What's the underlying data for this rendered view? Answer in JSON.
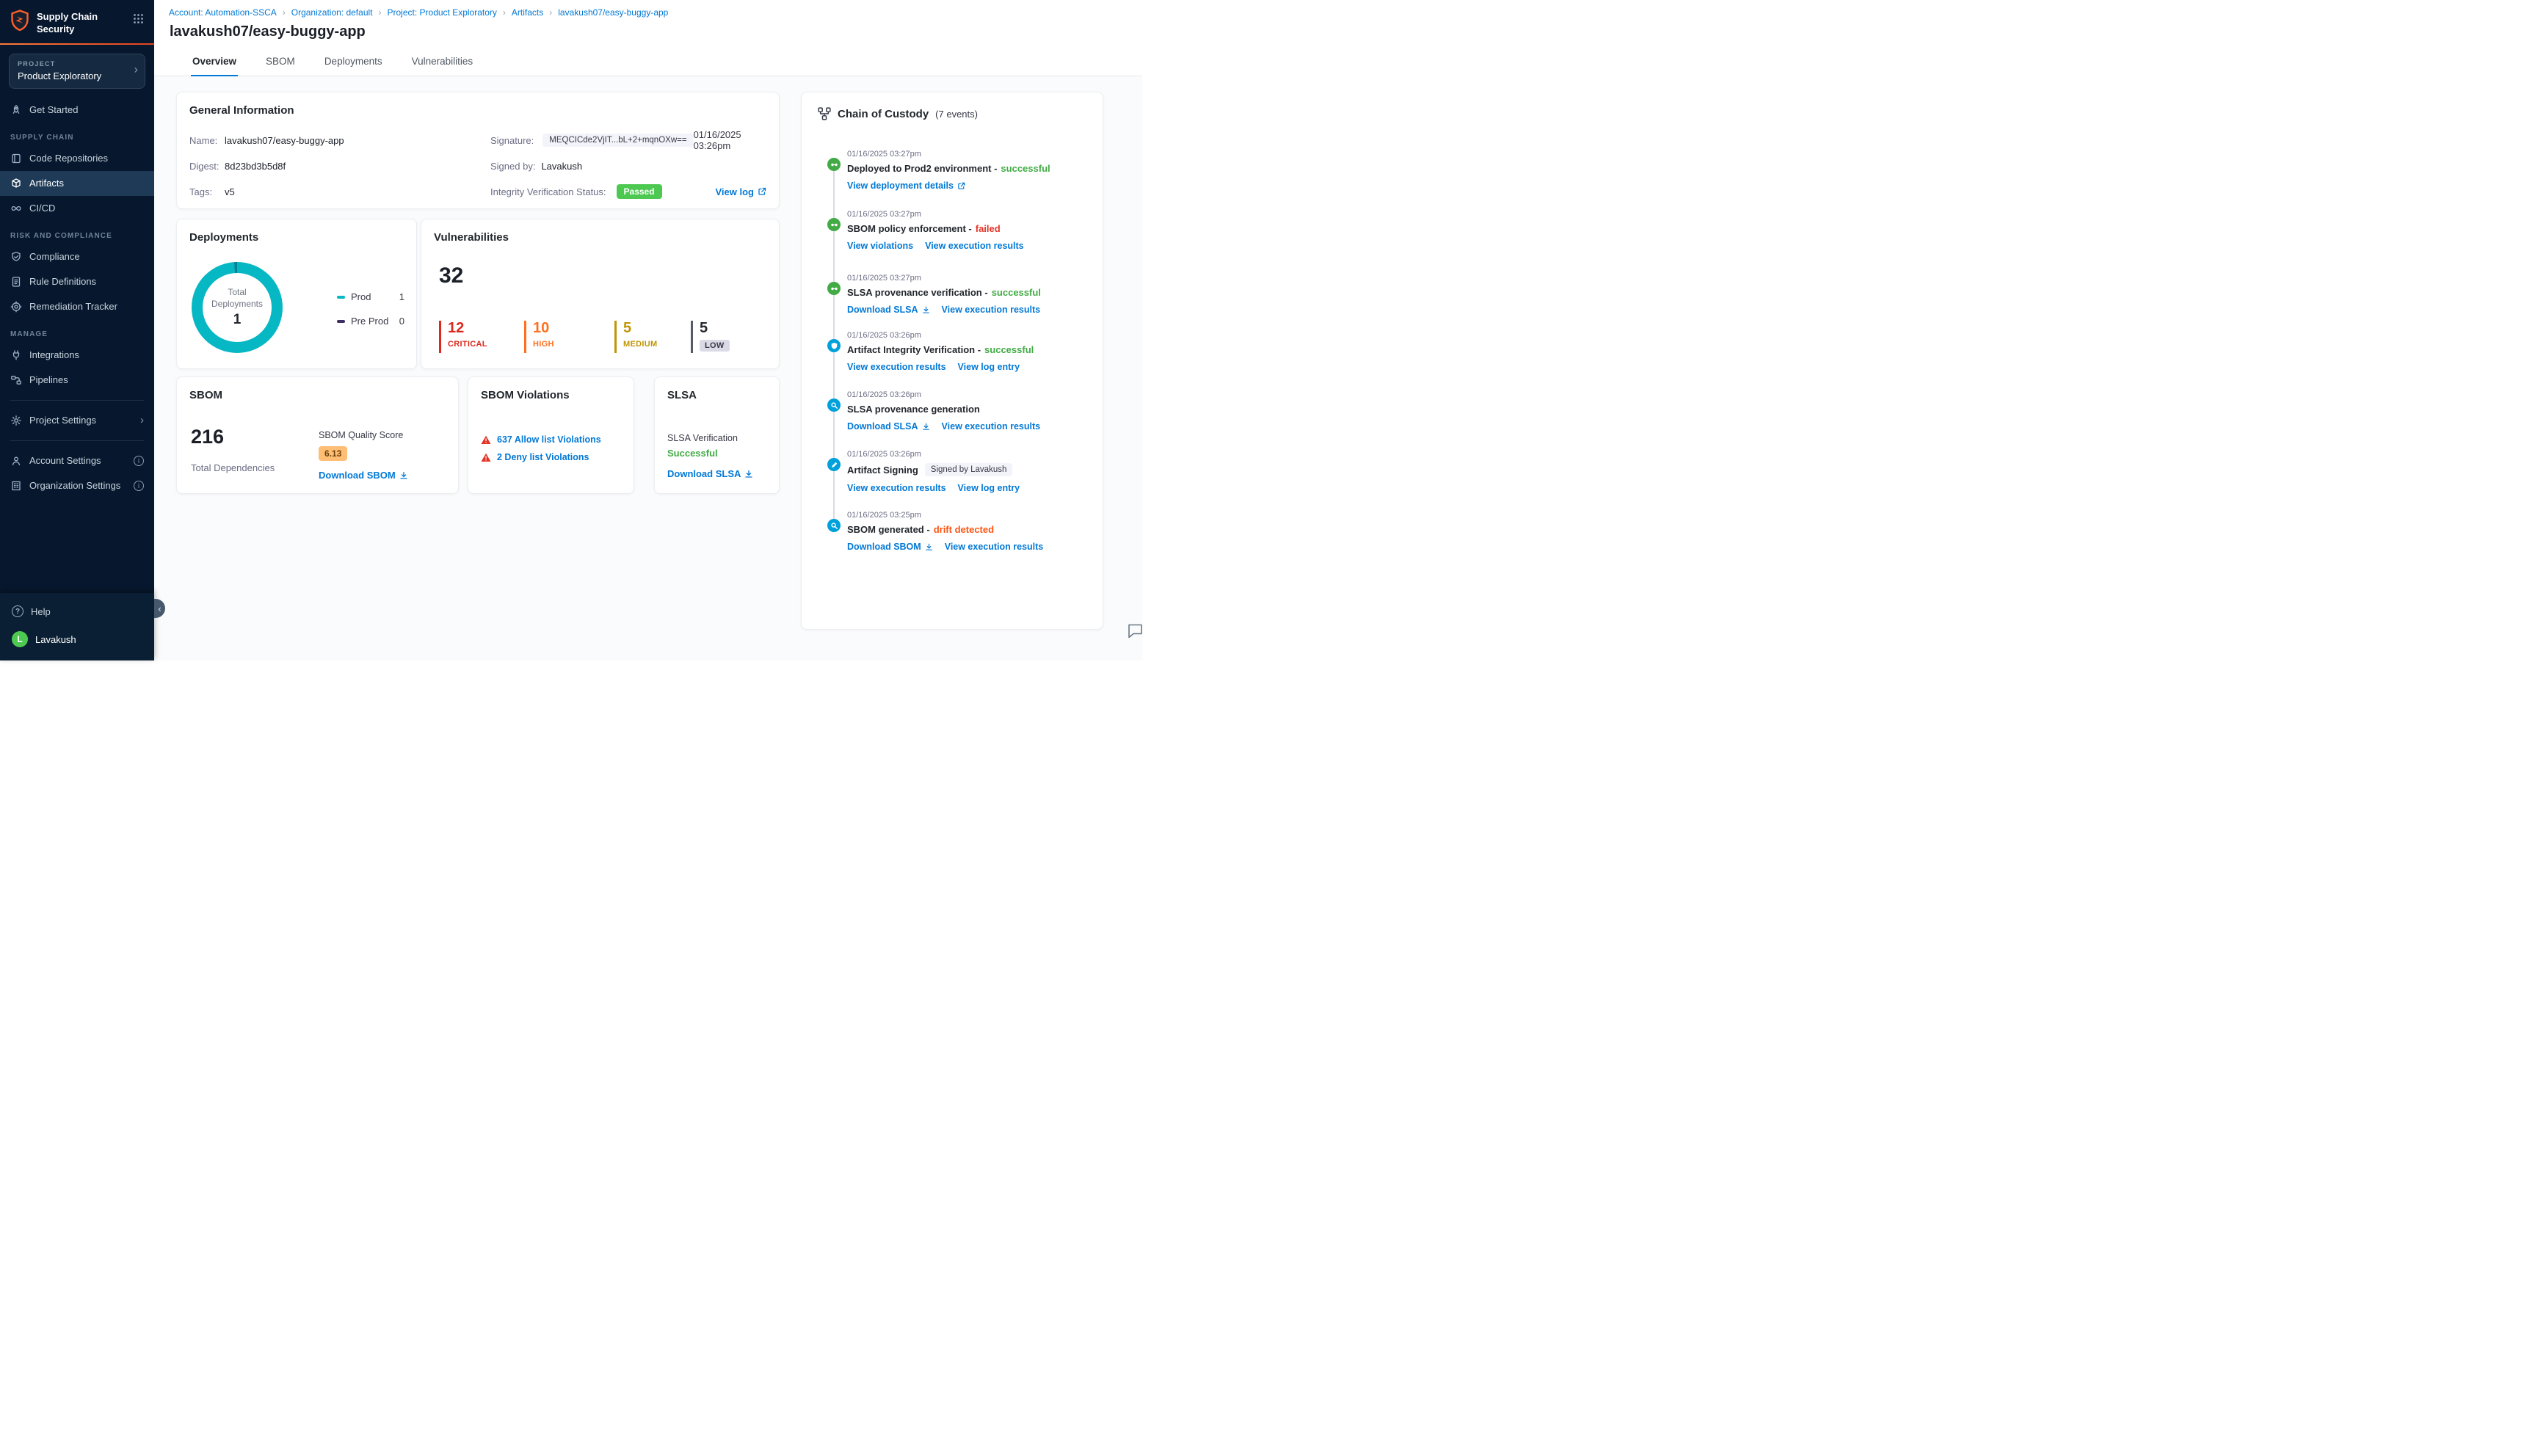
{
  "colors": {
    "primary_blue": "#0278d5",
    "success_green": "#42ab45",
    "failed_red": "#e43326",
    "drift_orange": "#ff5310",
    "passed_badge_green": "#4dc952",
    "sidebar_bg": "#07182e",
    "donut_teal": "#06b7c4",
    "preprod_purple": "#3f2e63"
  },
  "sidebar": {
    "brand_line1": "Supply Chain",
    "brand_line2": "Security",
    "project_label": "PROJECT",
    "project_name": "Product Exploratory",
    "get_started": "Get Started",
    "supply_chain_header": "SUPPLY CHAIN",
    "code_repositories": "Code Repositories",
    "artifacts": "Artifacts",
    "cicd": "CI/CD",
    "risk_header": "RISK AND COMPLIANCE",
    "compliance": "Compliance",
    "rule_definitions": "Rule Definitions",
    "remediation_tracker": "Remediation Tracker",
    "manage_header": "MANAGE",
    "integrations": "Integrations",
    "pipelines": "Pipelines",
    "project_settings": "Project Settings",
    "account_settings": "Account Settings",
    "organization_settings": "Organization Settings",
    "help": "Help",
    "user_initial": "L",
    "user_name": "Lavakush"
  },
  "breadcrumb": {
    "items": [
      "Account: Automation-SSCA",
      "Organization: default",
      "Project: Product Exploratory",
      "Artifacts",
      "lavakush07/easy-buggy-app"
    ]
  },
  "page": {
    "title": "lavakush07/easy-buggy-app",
    "tabs": [
      "Overview",
      "SBOM",
      "Deployments",
      "Vulnerabilities"
    ]
  },
  "general": {
    "title": "General Information",
    "name_label": "Name:",
    "name_value": "lavakush07/easy-buggy-app",
    "digest_label": "Digest:",
    "digest_value": "8d23bd3b5d8f",
    "tags_label": "Tags:",
    "tags_value": "v5",
    "signature_label": "Signature:",
    "signature_value": "MEQCICde2VjIT...bL+2+mqnOXw==",
    "signature_time": "01/16/2025 03:26pm",
    "signed_by_label": "Signed by:",
    "signed_by_value": "Lavakush",
    "integrity_label": "Integrity Verification Status:",
    "integrity_badge": "Passed",
    "view_log": "View log"
  },
  "deployments_card": {
    "title": "Deployments",
    "center_label_line1": "Total",
    "center_label_line2": "Deployments",
    "total": "1",
    "legend": [
      {
        "label": "Prod",
        "value": "1",
        "color": "#06b7c4"
      },
      {
        "label": "Pre Prod",
        "value": "0",
        "color": "#3f2e63"
      }
    ]
  },
  "vulnerabilities_card": {
    "title": "Vulnerabilities",
    "total": "32",
    "severities": [
      {
        "count": "12",
        "label": "CRITICAL",
        "color": "#da291d"
      },
      {
        "count": "10",
        "label": "HIGH",
        "color": "#ff7020"
      },
      {
        "count": "5",
        "label": "MEDIUM",
        "color": "#c09507"
      },
      {
        "count": "5",
        "label": "LOW",
        "color": "#545b64"
      }
    ]
  },
  "sbom_card": {
    "title": "SBOM",
    "total": "216",
    "total_label": "Total Dependencies",
    "quality_label": "SBOM Quality Score",
    "quality_score": "6.13",
    "download_label": "Download SBOM"
  },
  "sbom_violations_card": {
    "title": "SBOM Violations",
    "allow": "637 Allow list Violations",
    "deny": "2 Deny list Violations"
  },
  "slsa_card": {
    "title": "SLSA",
    "verification_label": "SLSA Verification",
    "status": "Successful",
    "download_label": "Download SLSA"
  },
  "custody": {
    "title": "Chain of Custody",
    "events_count": "(7 events)",
    "events": [
      {
        "time": "01/16/2025 03:27pm",
        "title": "Deployed to Prod2 environment -",
        "status": "successful",
        "links": [
          {
            "label": "View deployment details",
            "icon": "external-link"
          }
        ]
      },
      {
        "time": "01/16/2025 03:27pm",
        "title": "SBOM policy enforcement -",
        "status": "failed",
        "links": [
          {
            "label": "View violations"
          },
          {
            "label": "View execution results"
          }
        ]
      },
      {
        "time": "01/16/2025 03:27pm",
        "title": "SLSA provenance verification -",
        "status": "successful",
        "links": [
          {
            "label": "Download SLSA",
            "icon": "download"
          },
          {
            "label": "View execution results"
          }
        ]
      },
      {
        "time": "01/16/2025 03:26pm",
        "title": "Artifact Integrity Verification -",
        "status": "successful",
        "links": [
          {
            "label": "View execution results"
          },
          {
            "label": "View log entry"
          }
        ]
      },
      {
        "time": "01/16/2025 03:26pm",
        "title": "SLSA provenance generation",
        "links": [
          {
            "label": "Download SLSA",
            "icon": "download"
          },
          {
            "label": "View execution results"
          }
        ]
      },
      {
        "time": "01/16/2025 03:26pm",
        "title": "Artifact Signing",
        "badge": "Signed by Lavakush",
        "links": [
          {
            "label": "View execution results"
          },
          {
            "label": "View log entry"
          }
        ]
      },
      {
        "time": "01/16/2025 03:25pm",
        "title": "SBOM generated -",
        "status": "drift detected",
        "links": [
          {
            "label": "Download SBOM",
            "icon": "download"
          },
          {
            "label": "View execution results"
          }
        ]
      }
    ]
  }
}
